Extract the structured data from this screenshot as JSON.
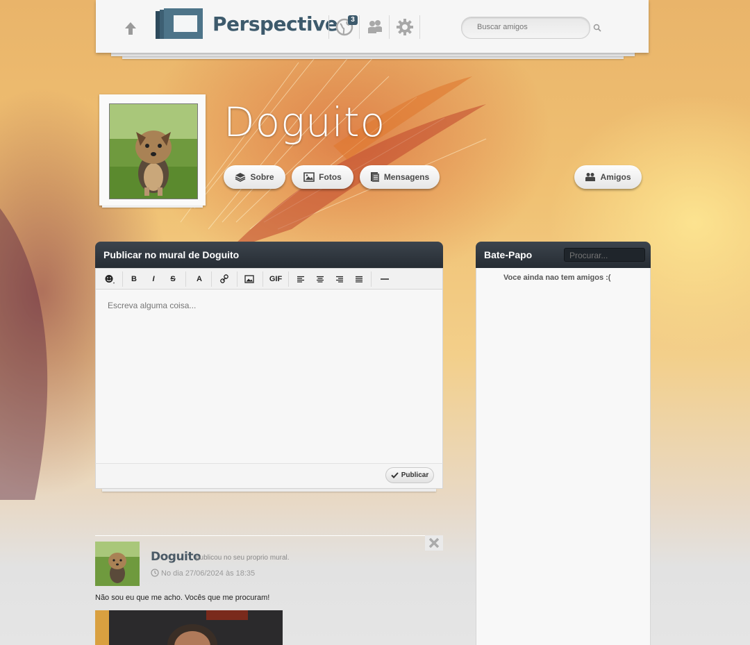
{
  "header": {
    "logo_text": "Perspective",
    "notifications_count": "3",
    "search_placeholder": "Buscar amigos"
  },
  "profile": {
    "name": "Doguito",
    "buttons": {
      "about": "Sobre",
      "photos": "Fotos",
      "messages": "Mensagens",
      "friends": "Amigos"
    }
  },
  "publish": {
    "title": "Publicar no mural de Doguito",
    "toolbar": {
      "bold": "B",
      "italic": "I",
      "strike": "S",
      "font_color": "A",
      "gif": "GIF"
    },
    "placeholder": "Escreva alguma coisa...",
    "submit_label": "Publicar"
  },
  "chat": {
    "title": "Bate-Papo",
    "search_placeholder": "Procurar...",
    "empty_message": "Voce ainda nao tem amigos :("
  },
  "post": {
    "author": "Doguito",
    "action": "publicou no seu proprio mural.",
    "date": "No dia 27/06/2024 às 18:35",
    "text": "Não sou eu que me acho. Vocês que me procuram!"
  },
  "colors": {
    "brand": "#3d5a6c",
    "panel_header": "#2f363e"
  }
}
